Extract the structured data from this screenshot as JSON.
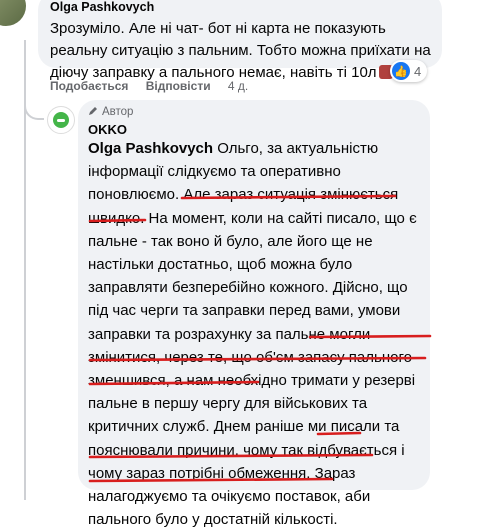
{
  "comment1": {
    "author": "Olga Pashkovych",
    "text": "Зрозуміло. Але ні чат- бот ні карта не показують реальну ситуацію з пальним. Тобто можна приїхати на діючу заправку а пального немає, навіть ті 10л",
    "reaction_count": "4",
    "actions": {
      "like": "Подобається",
      "reply": "Відповісти",
      "time": "4 д."
    }
  },
  "reply": {
    "author_badge": "Автор",
    "author": "OKKO",
    "tag": "Olga Pashkovych",
    "text": " Ольго, за актуальністю інформації слідкуємо та оперативно поновлюємо. Але зараз ситуація змінюється швидко. На момент, коли на сайті писало, що є пальне - так воно й було, але його ще не настільки достатньо, щоб можна було заправляти безперебійно кожного. Дійсно, що під час черги та заправки перед вами, умови заправки та розрахунку за пальне могли змінитися, через те, що об'єм запасу пального зменшився, а нам необхідно тримати у резерві пальне в першу чергу для військових та критичних служб. Днем раніше ми писали та пояснювали причини, чому так відбувається і чому зараз потрібні обмеження. Зараз налагоджуємо та очікуємо поставок, аби пального було у достатній кількості."
  },
  "colors": {
    "underline": "#d81e1e",
    "bubble": "#f0f2f5",
    "like": "#1877f2",
    "okko": "#44b549"
  }
}
